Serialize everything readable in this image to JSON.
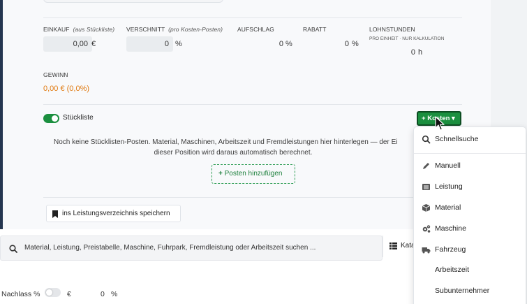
{
  "colors": {
    "accent_green": "#1b8f3f",
    "profit_orange": "#e07a10",
    "panel_border": "#253650"
  },
  "costs": {
    "einkauf": {
      "label": "EINKAUF",
      "hint": "(aus Stückliste)",
      "value": "0,00",
      "unit": "€"
    },
    "verschnitt": {
      "label": "VERSCHNITT",
      "hint": "(pro Kosten-Posten)",
      "value": "0",
      "unit": "%"
    },
    "aufschlag": {
      "label": "AUFSCHLAG",
      "value": "0",
      "unit": "%"
    },
    "rabatt": {
      "label": "RABATT",
      "value": "0",
      "unit": "%"
    },
    "lohnstunden": {
      "label": "LOHNSTUNDEN",
      "sub_a": "PRO EINHEIT",
      "sub_b": "NUR KALKULATION",
      "value": "0",
      "unit": "h"
    }
  },
  "gewinn": {
    "label": "GEWINN",
    "value": "0,00 € (0,0%)"
  },
  "stueckliste": {
    "label": "Stückliste",
    "enabled": true
  },
  "kosten_button": {
    "plus": "+",
    "label": "Kosten",
    "caret": "▾"
  },
  "empty_state": {
    "line1": "Noch keine Stücklisten-Posten. Material, Maschinen, Arbeitszeit und Fremdleistungen hier hinterlegen — der Ei",
    "line2": "dieser Position wird daraus automatisch berechnet."
  },
  "add_posten": {
    "plus": "+",
    "label": "Posten hinzufügen"
  },
  "save_lv": {
    "label": "ins Leistungsverzeichnis speichern"
  },
  "search": {
    "placeholder": "Material, Leistung, Preistabelle, Maschine, Fuhrpark, Fremdleistung oder Arbeitszeit suchen ..."
  },
  "katalog": {
    "label": "Kata"
  },
  "nachlass": {
    "label": "Nachlass",
    "left_unit": "%",
    "right_unit": "€",
    "value": "0",
    "value_unit": "%",
    "enabled": false
  },
  "dropdown": {
    "items": [
      {
        "label": "Schnellsuche",
        "icon": "search-icon"
      },
      {
        "label": "Manuell",
        "icon": "pencil-icon"
      },
      {
        "label": "Leistung",
        "icon": "list-icon"
      },
      {
        "label": "Material",
        "icon": "box-icon"
      },
      {
        "label": "Maschine",
        "icon": "gears-icon"
      },
      {
        "label": "Fahrzeug",
        "icon": "truck-icon"
      },
      {
        "label": "Arbeitszeit",
        "icon": ""
      },
      {
        "label": "Subunternehmer",
        "icon": ""
      }
    ]
  }
}
